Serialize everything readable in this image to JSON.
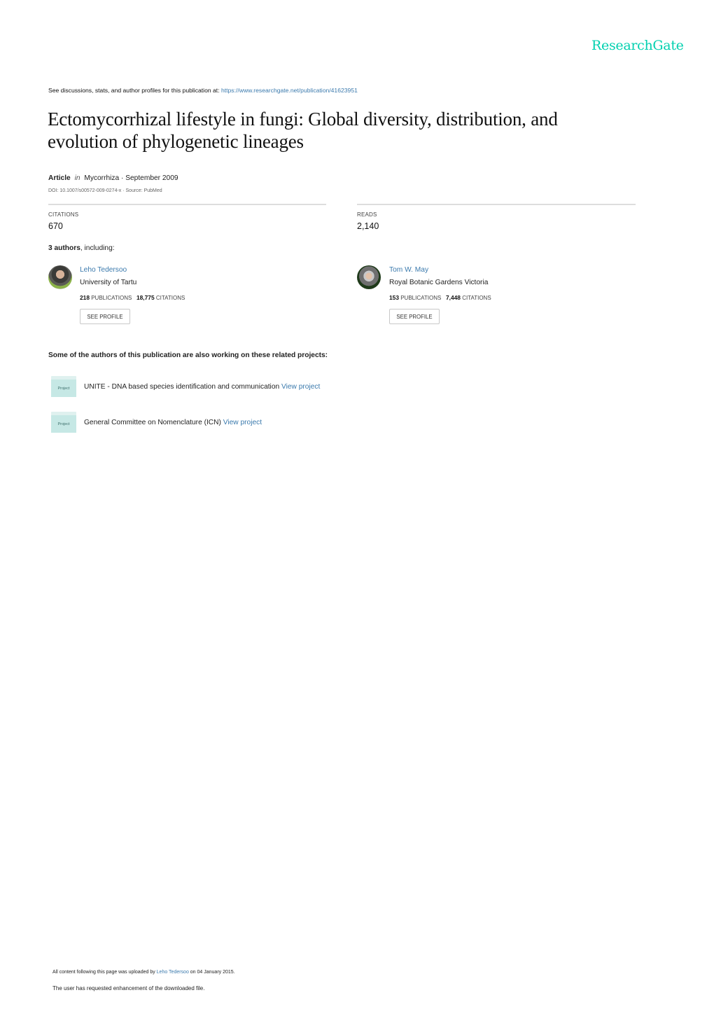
{
  "brand": {
    "name": "ResearchGate",
    "color": "#00d0af"
  },
  "header": {
    "see_prefix": "See discussions, stats, and author profiles for this publication at: ",
    "publication_url": "https://www.researchgate.net/publication/41623951"
  },
  "publication": {
    "title": "Ectomycorrhizal lifestyle in fungi: Global diversity, distribution, and evolution of phylogenetic lineages",
    "type": "Article",
    "in_label": "in",
    "journal_date": "Mycorrhiza · September 2009",
    "doi_line": "DOI: 10.1007/s00572-009-0274-x · Source: PubMed"
  },
  "stats": {
    "citations_label": "CITATIONS",
    "citations_value": "670",
    "reads_label": "READS",
    "reads_value": "2,140"
  },
  "authors": {
    "count_text": "3 authors",
    "suffix": ", including:",
    "list": [
      {
        "name": "Leho Tedersoo",
        "institution": "University of Tartu",
        "publications": "218",
        "publications_label": "PUBLICATIONS",
        "citations": "18,775",
        "citations_label": "CITATIONS",
        "button": "SEE PROFILE"
      },
      {
        "name": "Tom W. May",
        "institution": "Royal Botanic Gardens Victoria",
        "publications": "153",
        "publications_label": "PUBLICATIONS",
        "citations": "7,448",
        "citations_label": "CITATIONS",
        "button": "SEE PROFILE"
      }
    ]
  },
  "related": {
    "title": "Some of the authors of this publication are also working on these related projects:",
    "projects": [
      {
        "icon_label": "Project",
        "name": "UNITE - DNA based species identification and communication",
        "link": "View project"
      },
      {
        "icon_label": "Project",
        "name": "General Committee on Nomenclature (ICN)",
        "link": "View project"
      }
    ]
  },
  "footer": {
    "uploaded_prefix": "All content following this page was uploaded by ",
    "uploader": "Leho Tedersoo",
    "uploaded_suffix": " on 04 January 2015.",
    "enhancement_note": "The user has requested enhancement of the downloaded file."
  },
  "colors": {
    "link": "#3b7aad",
    "folder": "#c6e8e5",
    "rule": "#dddddd"
  }
}
